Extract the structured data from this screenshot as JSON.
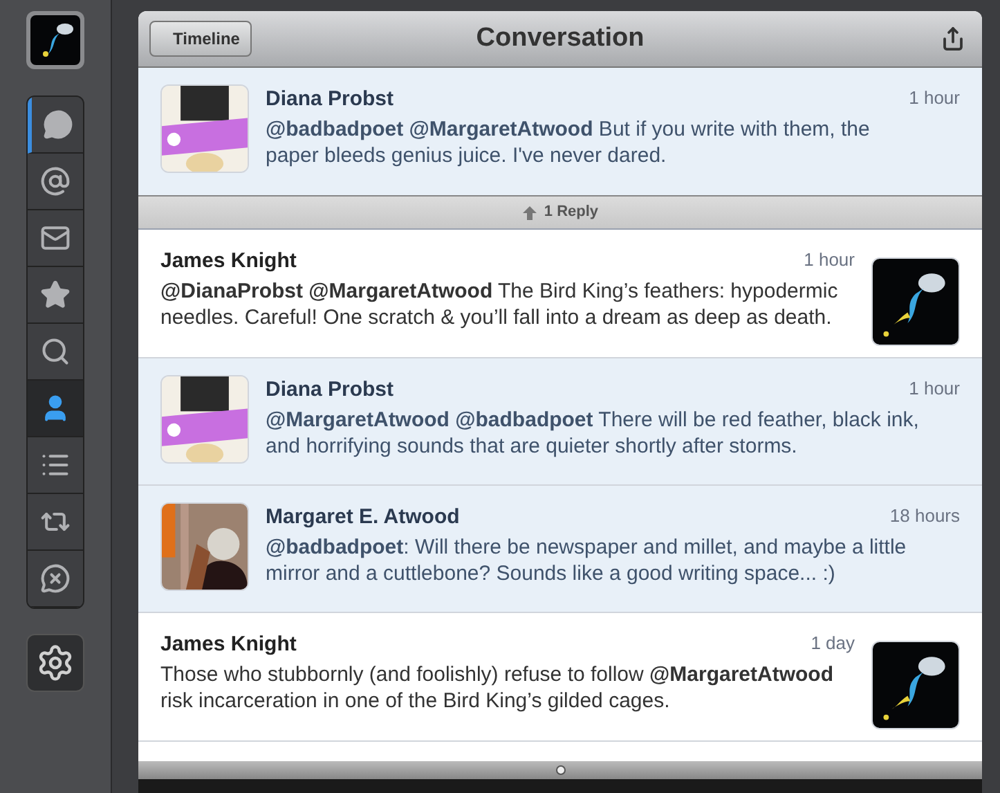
{
  "sidebar": {
    "items": [
      {
        "selected": false,
        "unread": true
      },
      {
        "selected": false,
        "unread": false
      },
      {
        "selected": false,
        "unread": false
      },
      {
        "selected": false,
        "unread": false
      },
      {
        "selected": false,
        "unread": false
      },
      {
        "selected": true,
        "unread": false
      },
      {
        "selected": false,
        "unread": false
      },
      {
        "selected": false,
        "unread": false
      },
      {
        "selected": false,
        "unread": false
      }
    ]
  },
  "header": {
    "back_button": "Timeline",
    "title": "Conversation"
  },
  "focused_tweet": {
    "name": "Diana Probst",
    "time": "1 hour",
    "text": "**@badbadpoet** **@MargaretAtwood** But if you write with them, the paper bleeds genius juice.  I've never dared."
  },
  "replies_bar": {
    "label": "1 Reply"
  },
  "tweets": [
    {
      "kind": "own",
      "name": "James Knight",
      "time": "1 hour",
      "text": "**@DianaProbst** **@MargaretAtwood** The Bird King’s feathers: hypodermic needles. Careful! One scratch & you’ll fall into a dream as deep as death."
    },
    {
      "kind": "other",
      "name": "Diana Probst",
      "time": "1 hour",
      "text": "**@MargaretAtwood** **@badbadpoet** There will be red feather, black ink, and horrifying sounds that are quieter shortly after storms."
    },
    {
      "kind": "other",
      "name": "Margaret E. Atwood",
      "time": "18 hours",
      "text": "**@badbadpoet**: Will there be newspaper and millet, and maybe a little mirror and a cuttlebone? Sounds like a good writing space... :)"
    },
    {
      "kind": "own",
      "name": "James Knight",
      "time": "1 day",
      "text": "Those who stubbornly (and foolishly) refuse to follow **@MargaretAtwood** risk incarceration in one of the Bird King’s gilded cages."
    }
  ]
}
